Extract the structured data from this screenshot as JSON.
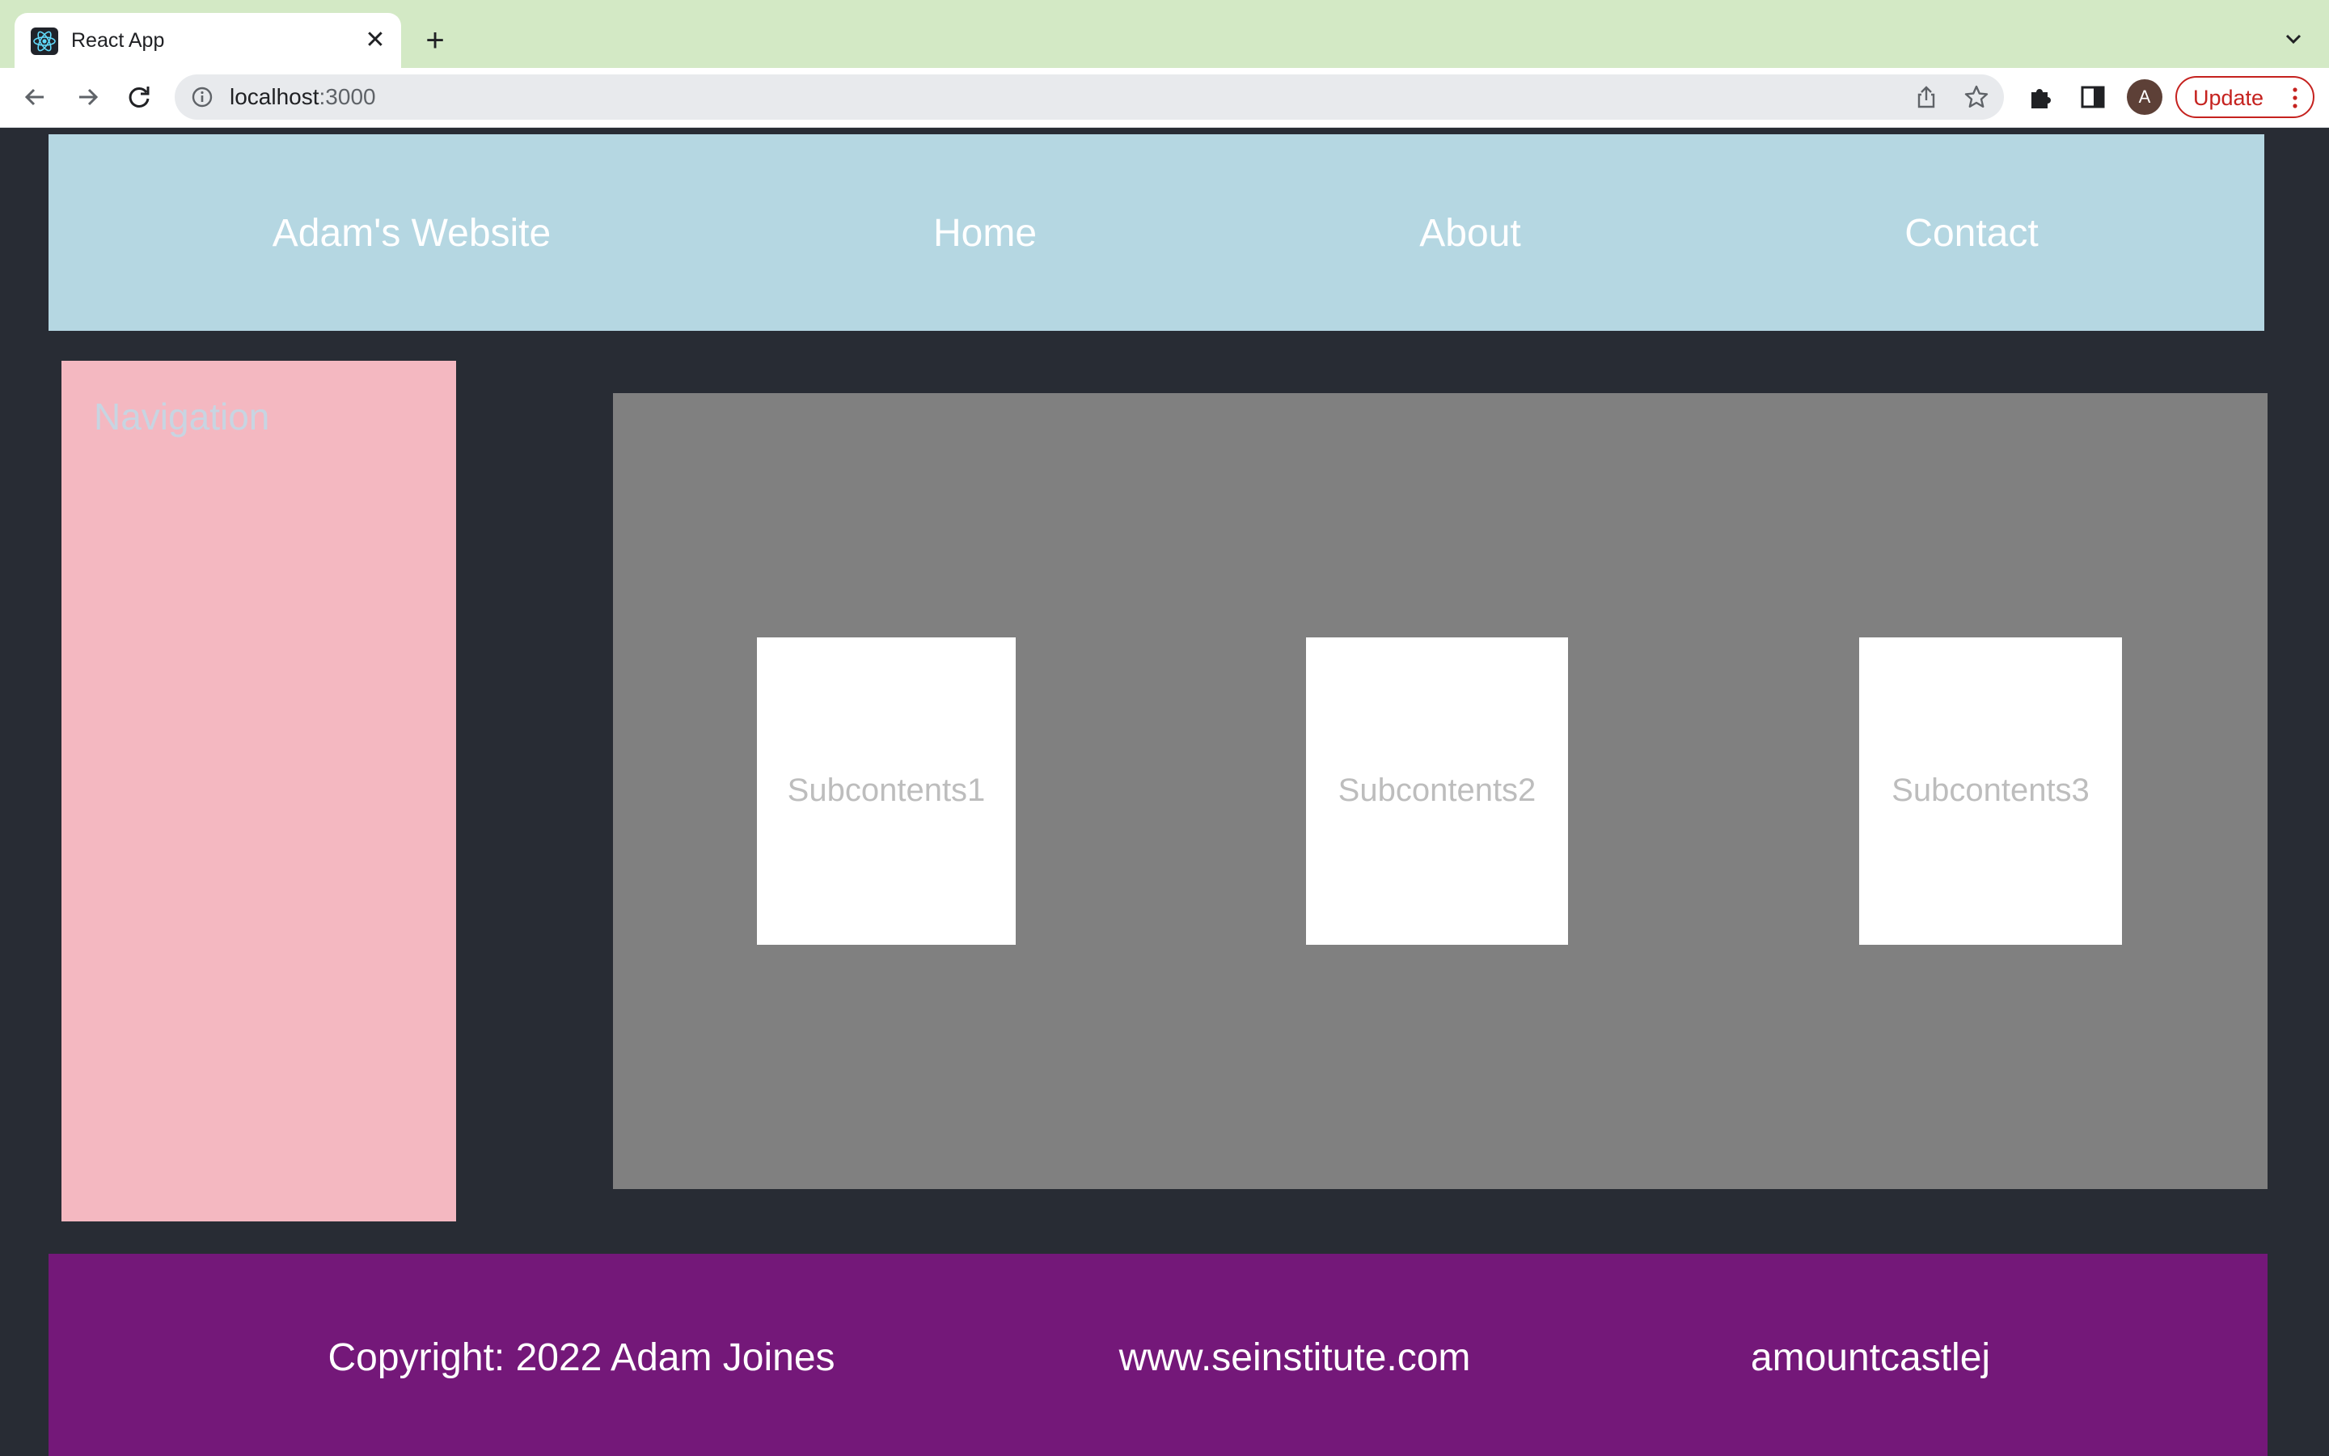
{
  "browser": {
    "tab": {
      "title": "React App",
      "favicon": "react-logo-icon"
    },
    "url_host": "localhost",
    "url_port": ":3000",
    "profile_initial": "A",
    "update_label": "Update",
    "colors": {
      "tabstrip": "#d3e9c5",
      "update": "#c5221f"
    }
  },
  "header": {
    "site_title": "Adam's Website",
    "nav": [
      "Home",
      "About",
      "Contact"
    ],
    "color": "#b5d7e2"
  },
  "sidebar": {
    "title": "Navigation",
    "color": "#f4b8c1"
  },
  "main": {
    "cards": [
      "Subcontents1",
      "Subcontents2",
      "Subcontents3"
    ],
    "color": "#808080"
  },
  "footer": {
    "copyright": "Copyright: 2022 Adam Joines",
    "website": "www.seinstitute.com",
    "handle": "amountcastlej",
    "color": "#741879"
  }
}
